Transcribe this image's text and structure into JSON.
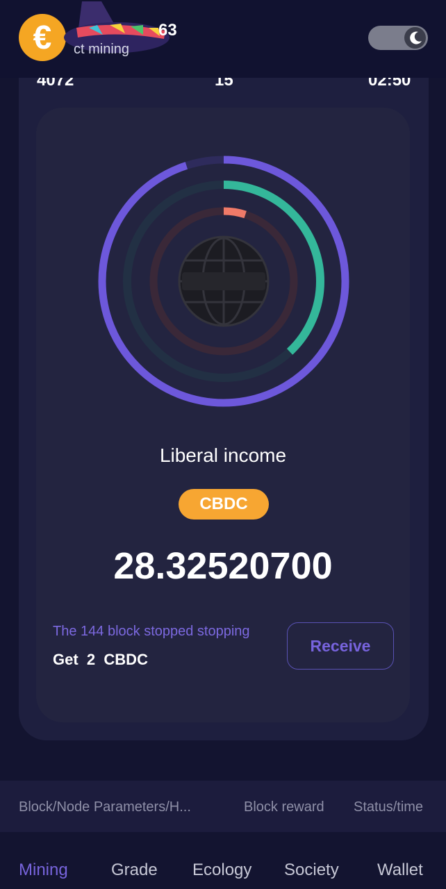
{
  "header": {
    "avatar_glyph": "€",
    "title": "63",
    "subtitle": "ct mining",
    "avatar_color": "#f5a623",
    "theme_toggle_icon": "moon-icon"
  },
  "stats": {
    "left": "4072",
    "center": "15",
    "right": "02:50"
  },
  "mining_panel": {
    "globe_icon": "globe-icon",
    "progress": {
      "outer_ring_fraction": 0.95,
      "middle_ring_fraction": 0.38,
      "inner_ring_fraction": 0.05
    },
    "ring_colors": {
      "outer": "#6d58db",
      "middle": "#34b79a",
      "inner": "#f07a68"
    },
    "income_label": "Liberal income",
    "token_badge": "CBDC",
    "amount": "28.32520700",
    "block_status": "The 144 block stopped stopping",
    "reward_prefix": "Get",
    "reward_amount": "2",
    "reward_token": "CBDC",
    "receive_button": "Receive"
  },
  "table_header": {
    "col1": "Block/Node Parameters/H...",
    "col2": "Block reward",
    "col3": "Status/time"
  },
  "bottom_nav": {
    "active_color": "#7764dc",
    "items": [
      {
        "label": "Mining"
      },
      {
        "label": "Grade"
      },
      {
        "label": "Ecology"
      },
      {
        "label": "Society"
      },
      {
        "label": "Wallet"
      }
    ]
  }
}
